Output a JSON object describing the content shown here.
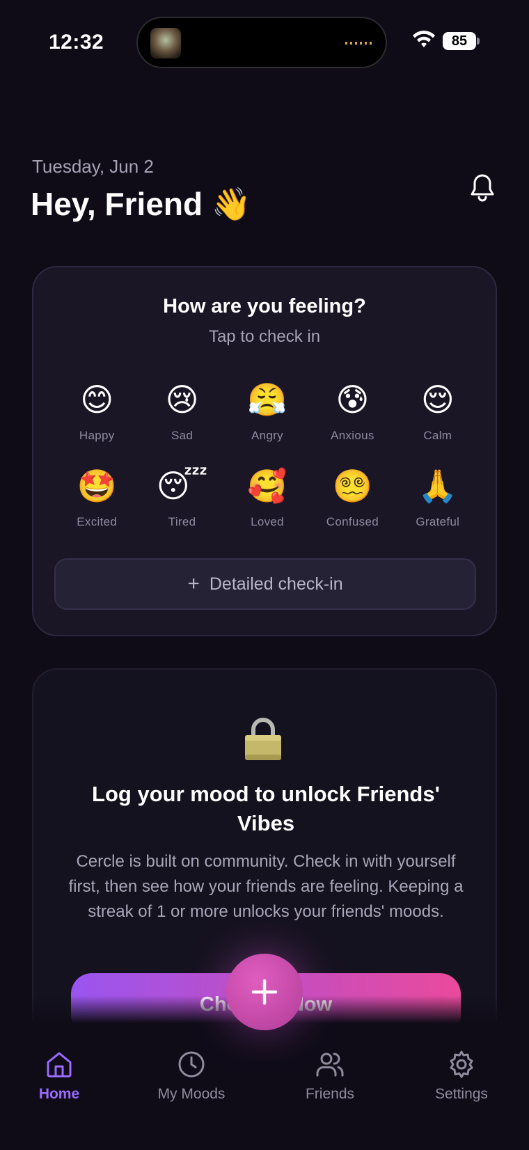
{
  "status_bar": {
    "time": "12:32",
    "battery": "85"
  },
  "header": {
    "date": "Tuesday, Jun 2",
    "greeting": "Hey, Friend 👋"
  },
  "mood_card": {
    "title": "How are you feeling?",
    "subtitle": "Tap to check in",
    "moods": [
      {
        "emoji": "😊",
        "label": "Happy"
      },
      {
        "emoji": "😢",
        "label": "Sad"
      },
      {
        "emoji": "😤",
        "label": "Angry"
      },
      {
        "emoji": "😰",
        "label": "Anxious"
      },
      {
        "emoji": "😌",
        "label": "Calm"
      },
      {
        "emoji": "🤩",
        "label": "Excited"
      },
      {
        "emoji": "😴",
        "label": "Tired"
      },
      {
        "emoji": "🥰",
        "label": "Loved"
      },
      {
        "emoji": "😵‍💫",
        "label": "Confused"
      },
      {
        "emoji": "🙏",
        "label": "Grateful"
      }
    ],
    "detailed_label": "Detailed check-in"
  },
  "lock_card": {
    "title": "Log your mood to unlock Friends' Vibes",
    "body": "Cercle is built on community. Check in with yourself first, then see how your friends are feeling. Keeping a streak of 1 or more unlocks your friends' moods.",
    "cta_label": "Check In Now"
  },
  "tab_bar": {
    "tabs": [
      {
        "label": "Home",
        "icon": "home-icon",
        "active": true
      },
      {
        "label": "My Moods",
        "icon": "clock-icon",
        "active": false
      },
      {
        "label": "Friends",
        "icon": "users-icon",
        "active": false
      },
      {
        "label": "Settings",
        "icon": "gear-icon",
        "active": false
      }
    ]
  },
  "colors": {
    "background": "#0f0c18",
    "card": "#1a1626",
    "accent_purple": "#9b6bff",
    "gradient_start": "#9a55f0",
    "gradient_end": "#ea4a9c"
  }
}
